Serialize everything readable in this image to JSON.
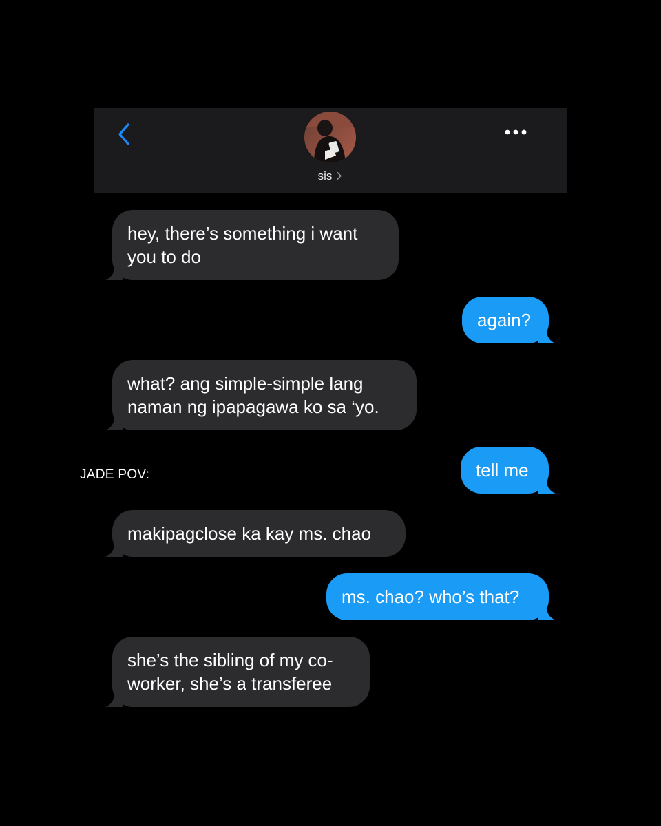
{
  "header": {
    "contact_name": "sis",
    "back_icon": "chevron-left-icon",
    "more_icon": "ellipsis-icon",
    "accent_color": "#1a8cff"
  },
  "side_label": "JADE POV:",
  "messages": [
    {
      "direction": "incoming",
      "lines": [
        "hey, there’s something i want",
        "you to do"
      ]
    },
    {
      "direction": "outgoing",
      "lines": [
        "again?"
      ]
    },
    {
      "direction": "incoming",
      "lines": [
        "what? ang simple-simple lang",
        "naman ng ipapagawa ko sa ‘yo."
      ]
    },
    {
      "direction": "outgoing",
      "lines": [
        "tell me"
      ]
    },
    {
      "direction": "incoming",
      "lines": [
        "makipagclose ka kay ms. chao"
      ]
    },
    {
      "direction": "outgoing",
      "lines": [
        "ms. chao? who’s that?"
      ]
    },
    {
      "direction": "incoming",
      "lines": [
        "she’s the sibling of my co-",
        "worker, she’s a transferee"
      ]
    }
  ],
  "colors": {
    "incoming_bubble": "#2c2c2e",
    "outgoing_bubble": "#1a9bf5",
    "background": "#000000",
    "header_background": "#1b1b1d"
  }
}
